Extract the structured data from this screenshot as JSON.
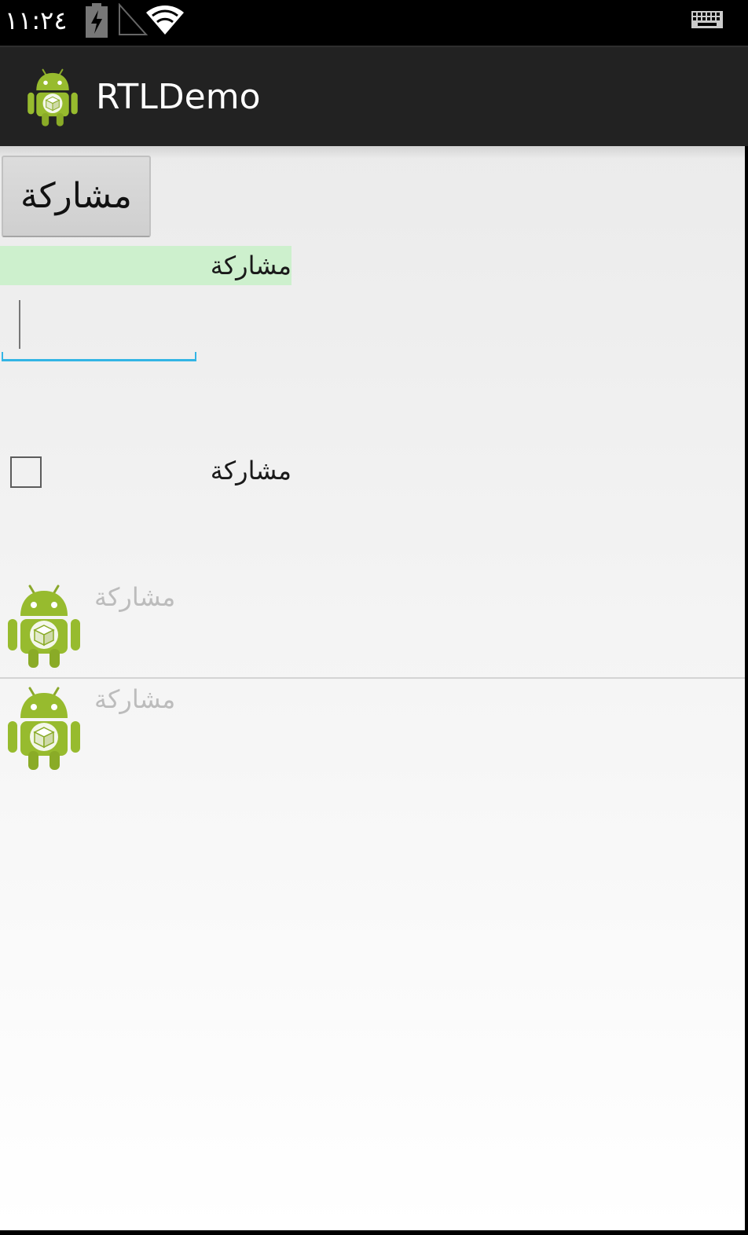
{
  "status_bar": {
    "time": "١١:٢٤",
    "icons": [
      "battery-charging-icon",
      "signal-icon",
      "wifi-icon",
      "keyboard-icon"
    ]
  },
  "action_bar": {
    "title": "RTLDemo",
    "icon": "android-robot-icon"
  },
  "content": {
    "button_label": "مشاركة",
    "highlighted_text": "مشاركة",
    "text_field": {
      "value": "",
      "placeholder": ""
    },
    "checkbox": {
      "label": "مشاركة",
      "checked": false
    },
    "list_items": [
      {
        "label": "مشاركة",
        "icon": "android-robot-icon"
      },
      {
        "label": "مشاركة",
        "icon": "android-robot-icon"
      }
    ]
  },
  "colors": {
    "status_bar_bg": "#000000",
    "action_bar_bg": "#222222",
    "highlight_bg": "#cdf0cd",
    "accent_underline": "#33b5e5",
    "android_green": "#a4c639",
    "list_label_color": "#bcbcbc"
  }
}
